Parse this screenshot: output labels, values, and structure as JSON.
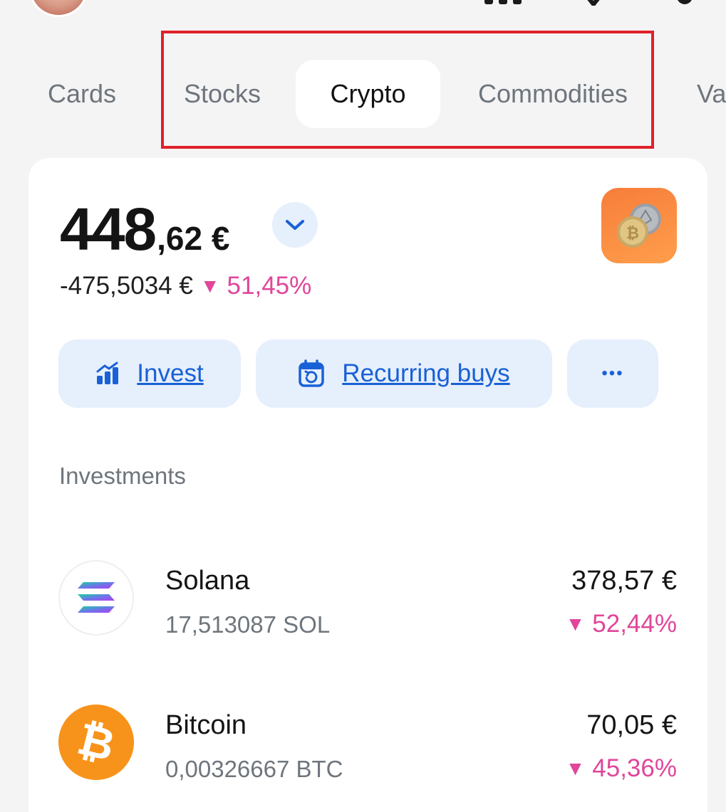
{
  "tabs": [
    {
      "label": "Cards",
      "active": false
    },
    {
      "label": "Stocks",
      "active": false
    },
    {
      "label": "Crypto",
      "active": true
    },
    {
      "label": "Commodities",
      "active": false
    },
    {
      "label": "Va",
      "active": false
    }
  ],
  "summary": {
    "balance_int": "448",
    "balance_dec": ",62 €",
    "change_abs": "-475,5034 €",
    "change_pct": "51,45%",
    "change_direction": "down"
  },
  "actions": {
    "invest_label": "Invest",
    "recurring_label": "Recurring buys",
    "more_label": "•••"
  },
  "investments": {
    "section_label": "Investments",
    "items": [
      {
        "name": "Solana",
        "quantity": "17,513087 SOL",
        "value": "378,57 €",
        "change_pct": "52,44%",
        "direction": "down",
        "icon": "solana-icon"
      },
      {
        "name": "Bitcoin",
        "quantity": "0,00326667 BTC",
        "value": "70,05 €",
        "change_pct": "45,36%",
        "direction": "down",
        "icon": "bitcoin-icon"
      }
    ]
  },
  "colors": {
    "accent": "#1961d6",
    "negative": "#e0469a",
    "highlight": "#e0202a",
    "background": "#f4f4f5"
  }
}
